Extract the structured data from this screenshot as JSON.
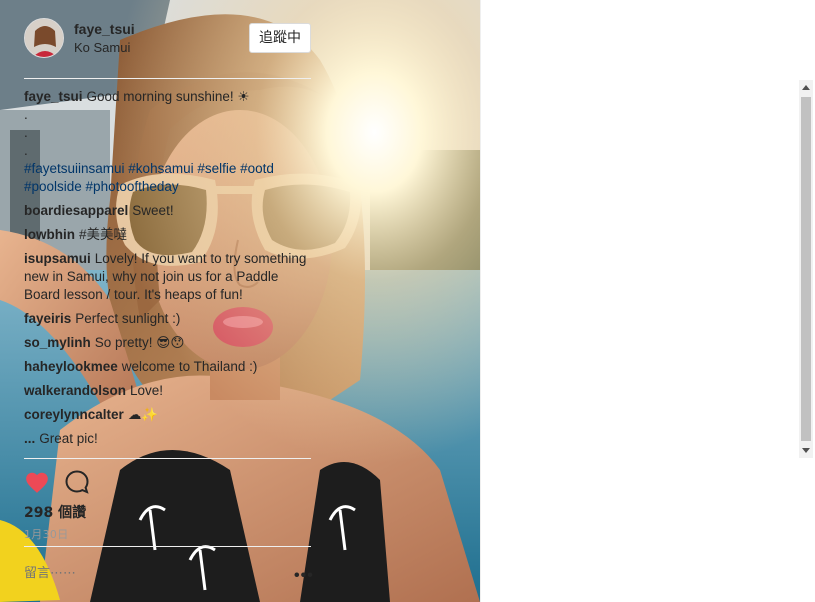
{
  "post": {
    "username": "faye_tsui",
    "location": "Ko Samui",
    "follow_label": "追蹤中",
    "caption_user": "faye_tsui",
    "caption_text": "Good morning sunshine! ☀",
    "caption_dots": [
      ".",
      ".",
      "."
    ],
    "hashtags_line1": "#fayetsuiinsamui #kohsamui #selfie #ootd",
    "hashtags_line2": "#poolside #photooftheday"
  },
  "comments": [
    {
      "user": "boardiesapparel",
      "text": "Sweet!"
    },
    {
      "user": "lowbhin",
      "text": "#美美噠"
    },
    {
      "user": "isupsamui",
      "text": "Lovely! If you want to try something new in Samui, why not join us for a Paddle Board lesson / tour. It's heaps of fun!"
    },
    {
      "user": "fayeiris",
      "text": "Perfect sunlight :)"
    },
    {
      "user": "so_mylinh",
      "text": "So pretty! 😎😯"
    },
    {
      "user": "haheylookmee",
      "text": "welcome to Thailand :)"
    },
    {
      "user": "walkerandolson",
      "text": "Love!"
    },
    {
      "user": "coreylynncalter",
      "text": "☁✨"
    },
    {
      "user": "...",
      "text": "Great pic!"
    }
  ],
  "stats": {
    "likes": "298 個讚",
    "date": "1月30日"
  },
  "add_comment": {
    "placeholder": "留言⋯⋯"
  },
  "icons": {
    "heart": "heart-icon",
    "comment": "comment-icon",
    "more": "more-options-icon"
  },
  "colors": {
    "heart": "#ed4956",
    "hashtag": "#003569"
  }
}
